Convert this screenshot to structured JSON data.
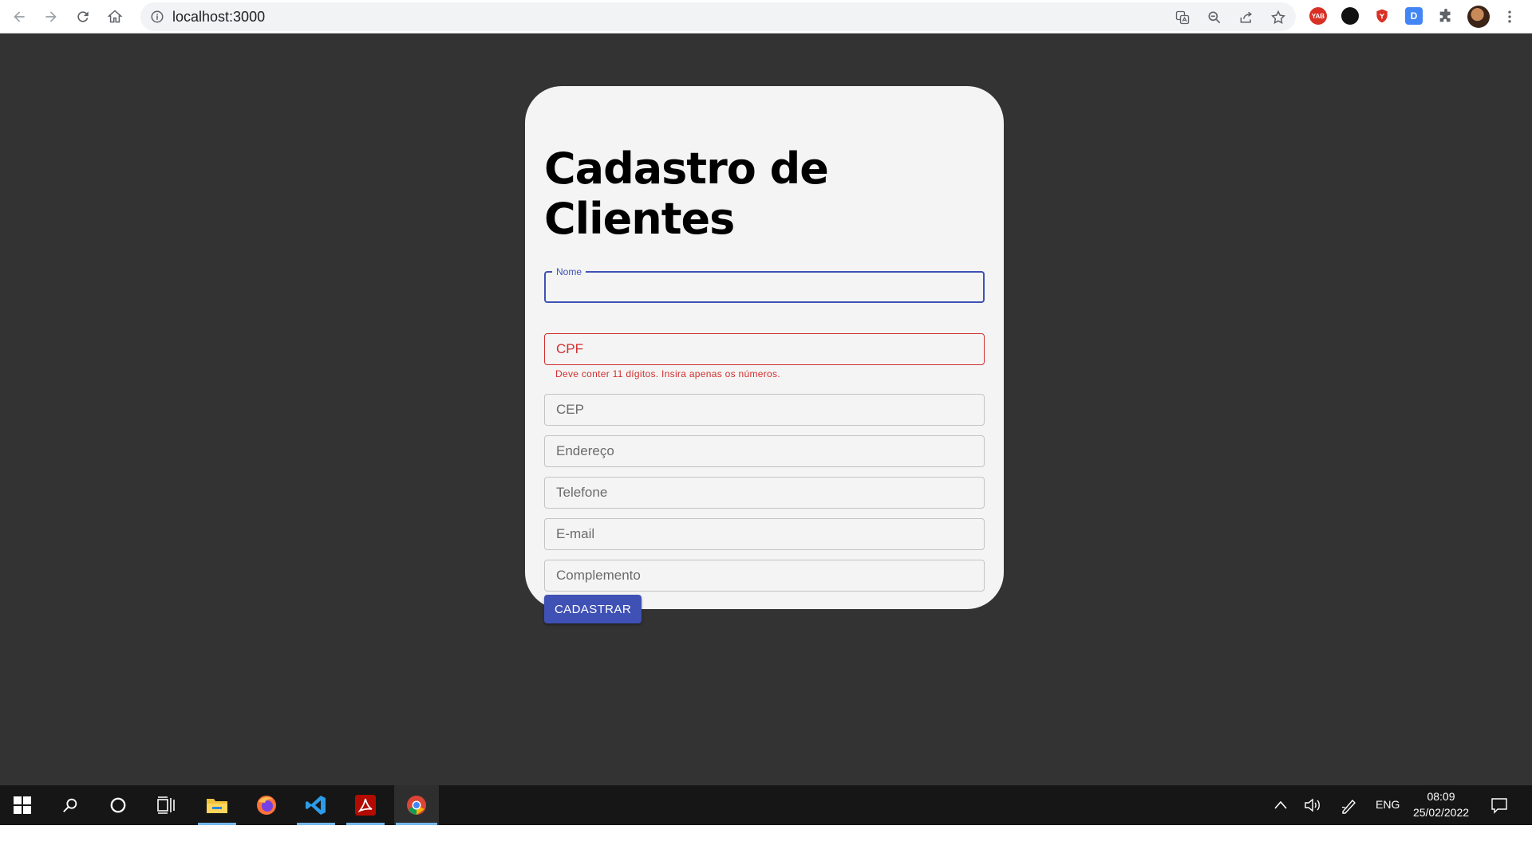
{
  "browser": {
    "url": "localhost:3000",
    "extensions": [
      {
        "name": "yab-extension-icon",
        "text": "YAB",
        "color": "#d93025"
      },
      {
        "name": "dark-extension-icon",
        "text": "",
        "color": "#111111"
      },
      {
        "name": "shield-extension-icon",
        "text": "",
        "color": "#d93025"
      },
      {
        "name": "d-extension-icon",
        "text": "D",
        "color": "#4285f4"
      }
    ]
  },
  "form": {
    "title": "Cadastro de Clientes",
    "fields": {
      "nome": "Nome",
      "cpf": "CPF",
      "cep": "CEP",
      "endereco": "Endereço",
      "telefone": "Telefone",
      "email": "E-mail",
      "complemento": "Complemento"
    },
    "cpf_error": "Deve conter 11 dígitos. Insira apenas os números.",
    "submit_label": "CADASTRAR",
    "accent_color": "#3f51b5",
    "error_color": "#d32f2f"
  },
  "taskbar": {
    "language": "ENG",
    "time": "08:09",
    "date": "25/02/2022",
    "apps": [
      "file-explorer",
      "firefox",
      "vscode",
      "acrobat",
      "chrome"
    ]
  }
}
